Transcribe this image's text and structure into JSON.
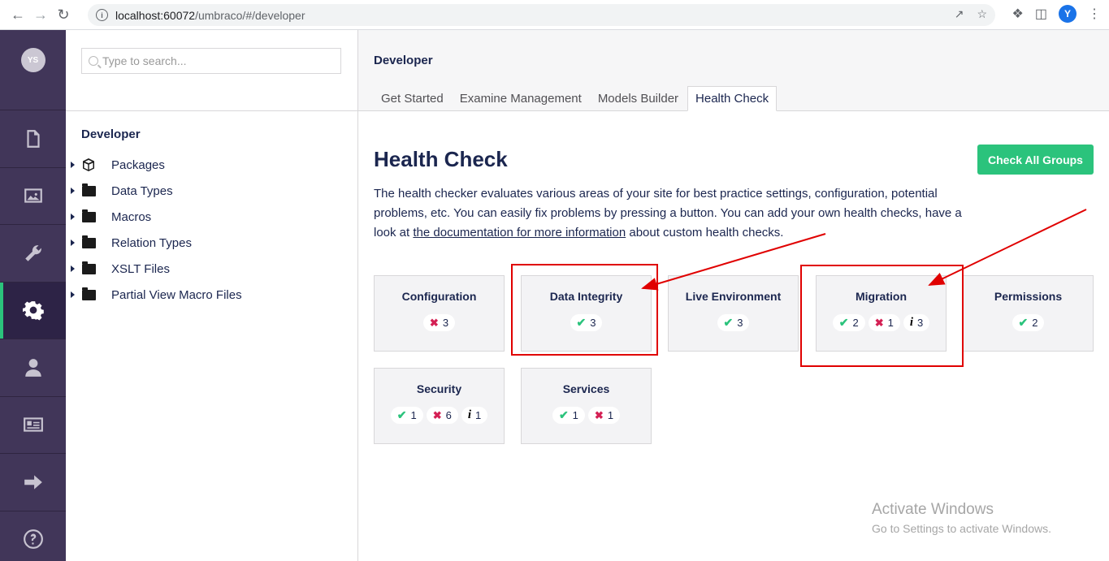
{
  "browser": {
    "url_host": "localhost:60072",
    "url_path": "/umbraco/#/developer",
    "profile_initial": "Y"
  },
  "user": {
    "initials": "YS"
  },
  "sections": [
    {
      "name": "content",
      "icon": "document-icon"
    },
    {
      "name": "media",
      "icon": "image-icon"
    },
    {
      "name": "settings",
      "icon": "wrench-icon"
    },
    {
      "name": "developer",
      "icon": "gear-icon",
      "active": true
    },
    {
      "name": "members",
      "icon": "user-icon"
    },
    {
      "name": "forms",
      "icon": "id-card-icon"
    },
    {
      "name": "translation",
      "icon": "arrow-right-icon"
    },
    {
      "name": "help",
      "icon": "help-icon"
    }
  ],
  "tree": {
    "search_placeholder": "Type to search...",
    "title": "Developer",
    "items": [
      {
        "label": "Packages",
        "icon": "package-icon"
      },
      {
        "label": "Data Types",
        "icon": "folder-icon"
      },
      {
        "label": "Macros",
        "icon": "folder-icon"
      },
      {
        "label": "Relation Types",
        "icon": "folder-icon"
      },
      {
        "label": "XSLT Files",
        "icon": "folder-icon"
      },
      {
        "label": "Partial View Macro Files",
        "icon": "folder-icon"
      }
    ]
  },
  "main": {
    "title": "Developer",
    "tabs": [
      "Get Started",
      "Examine Management",
      "Models Builder",
      "Health Check"
    ],
    "active_tab": "Health Check"
  },
  "health_check": {
    "heading": "Health Check",
    "check_all_label": "Check All Groups",
    "description_before": "The health checker evaluates various areas of your site for best practice settings, configuration, potential problems, etc. You can easily fix problems by pressing a button. You can add your own health checks, have a look at ",
    "description_link": "the documentation for more information",
    "description_after": " about custom health checks.",
    "groups": [
      {
        "name": "Configuration",
        "success": null,
        "error": "3",
        "info": null
      },
      {
        "name": "Data Integrity",
        "success": "3",
        "error": null,
        "info": null
      },
      {
        "name": "Live Environment",
        "success": "3",
        "error": null,
        "info": null
      },
      {
        "name": "Migration",
        "success": "2",
        "error": "1",
        "info": "3"
      },
      {
        "name": "Permissions",
        "success": "2",
        "error": null,
        "info": null
      },
      {
        "name": "Security",
        "success": "1",
        "error": "6",
        "info": "1"
      },
      {
        "name": "Services",
        "success": "1",
        "error": "1",
        "info": null
      }
    ]
  },
  "watermark": {
    "line1": "Activate Windows",
    "line2": "Go to Settings to activate Windows."
  },
  "colors": {
    "section_bar": "#413659",
    "accent_green": "#2bc37c",
    "error_red": "#d42054",
    "annotation_red": "#e00000"
  }
}
